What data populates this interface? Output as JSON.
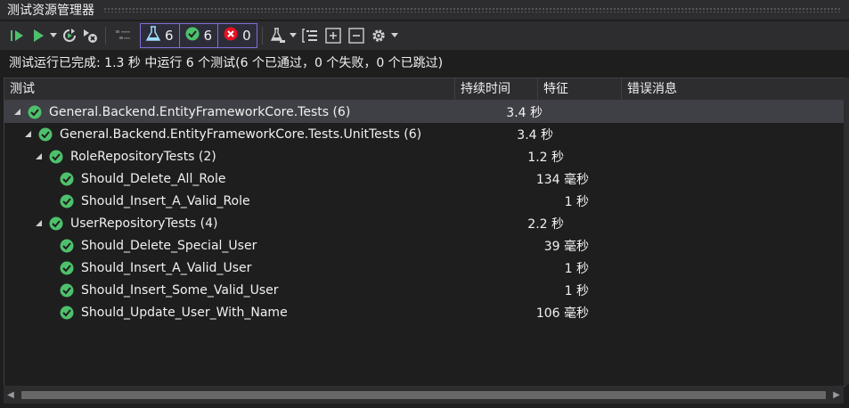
{
  "window": {
    "title": "测试资源管理器"
  },
  "toolbar": {
    "counters": [
      {
        "icon": "flask-icon",
        "value": "6"
      },
      {
        "icon": "passed-icon",
        "value": "6"
      },
      {
        "icon": "failed-icon",
        "value": "0"
      }
    ]
  },
  "summary": {
    "text": "测试运行已完成: 1.3 秒 中运行 6 个测试(6 个已通过，0 个失败，0 个已跳过)"
  },
  "columns": [
    "测试",
    "持续时间",
    "特征",
    "错误消息"
  ],
  "rows": [
    {
      "name": "General.Backend.EntityFrameworkCore.Tests (6)",
      "duration": "3.4 秒",
      "level": 0,
      "expandable": true,
      "selected": true
    },
    {
      "name": "General.Backend.EntityFrameworkCore.Tests.UnitTests (6)",
      "duration": "3.4 秒",
      "level": 1,
      "expandable": true,
      "selected": false
    },
    {
      "name": "RoleRepositoryTests (2)",
      "duration": "1.2 秒",
      "level": 2,
      "expandable": true,
      "selected": false
    },
    {
      "name": "Should_Delete_All_Role",
      "duration": "134 毫秒",
      "level": 3,
      "expandable": false,
      "selected": false
    },
    {
      "name": "Should_Insert_A_Valid_Role",
      "duration": "1 秒",
      "level": 3,
      "expandable": false,
      "selected": false
    },
    {
      "name": "UserRepositoryTests (4)",
      "duration": "2.2 秒",
      "level": 2,
      "expandable": true,
      "selected": false
    },
    {
      "name": "Should_Delete_Special_User",
      "duration": "39 毫秒",
      "level": 3,
      "expandable": false,
      "selected": false
    },
    {
      "name": "Should_Insert_A_Valid_User",
      "duration": "1 秒",
      "level": 3,
      "expandable": false,
      "selected": false
    },
    {
      "name": "Should_Insert_Some_Valid_User",
      "duration": "1 秒",
      "level": 3,
      "expandable": false,
      "selected": false
    },
    {
      "name": "Should_Update_User_With_Name",
      "duration": "106 毫秒",
      "level": 3,
      "expandable": false,
      "selected": false
    }
  ],
  "colors": {
    "passed": "#4ec06c",
    "failed": "#e81123",
    "accent": "#7f6fd6"
  }
}
